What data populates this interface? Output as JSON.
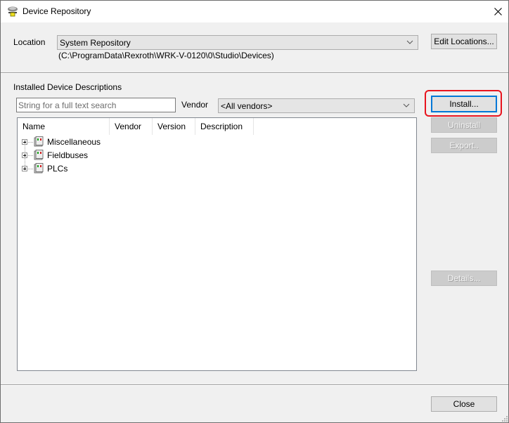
{
  "window": {
    "title": "Device Repository",
    "app_icon": "device-repository-icon",
    "close_icon": "close-icon"
  },
  "location": {
    "label": "Location",
    "selected": "System Repository",
    "path": "(C:\\ProgramData\\Rexroth\\WRK-V-0120\\0\\Studio\\Devices)",
    "edit_button": "Edit Locations..."
  },
  "installed": {
    "section_label": "Installed Device Descriptions",
    "search_placeholder": "String for a full text search",
    "search_value": "",
    "vendor_label": "Vendor",
    "vendor_selected": "<All vendors>"
  },
  "tree": {
    "columns": [
      "Name",
      "Vendor",
      "Version",
      "Description"
    ],
    "nodes": [
      {
        "label": "Miscellaneous",
        "expanded": false
      },
      {
        "label": "Fieldbuses",
        "expanded": false
      },
      {
        "label": "PLCs",
        "expanded": false
      }
    ]
  },
  "buttons": {
    "install": "Install...",
    "uninstall": "Uninstall",
    "export": "Export..",
    "details": "Details...",
    "close": "Close"
  },
  "colors": {
    "highlight": "#e8141e",
    "focus": "#0078d7"
  }
}
